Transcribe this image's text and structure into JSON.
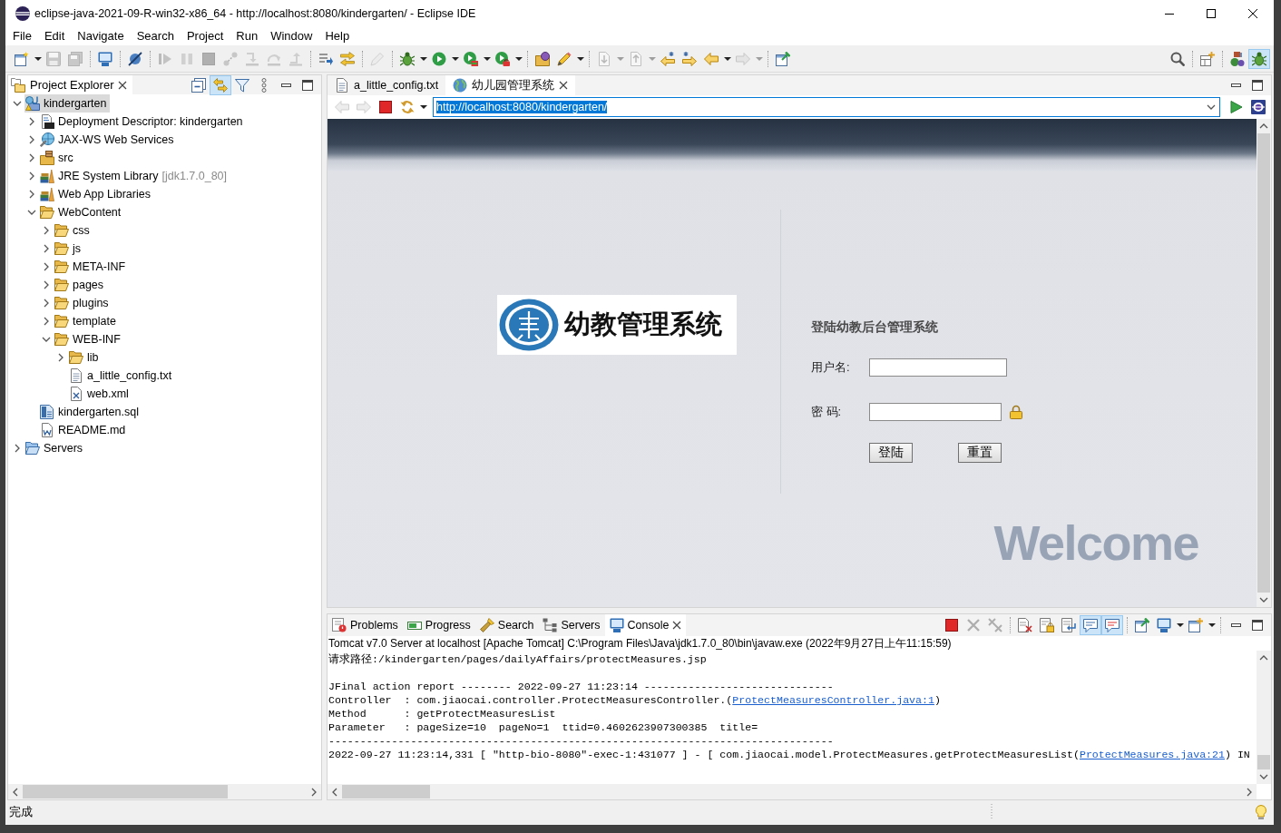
{
  "window": {
    "title": "eclipse-java-2021-09-R-win32-x86_64 - http://localhost:8080/kindergarten/ - Eclipse IDE"
  },
  "menu": [
    "File",
    "Edit",
    "Navigate",
    "Search",
    "Project",
    "Run",
    "Window",
    "Help"
  ],
  "toolbar": {
    "groups": [
      {
        "buttons": [
          {
            "kind": "new",
            "disabled": false,
            "dropdown": true
          },
          {
            "kind": "save",
            "disabled": true
          },
          {
            "kind": "save-all",
            "disabled": true
          }
        ]
      },
      {
        "buttons": [
          {
            "kind": "console",
            "disabled": false
          }
        ]
      },
      {
        "buttons": [
          {
            "kind": "skip-breakpoints",
            "disabled": false
          }
        ]
      },
      {
        "buttons": [
          {
            "kind": "resume",
            "disabled": true
          },
          {
            "kind": "suspend",
            "disabled": true
          },
          {
            "kind": "terminate",
            "disabled": true
          },
          {
            "kind": "disconnect",
            "disabled": true
          },
          {
            "kind": "step-into",
            "disabled": true
          },
          {
            "kind": "step-over",
            "disabled": true
          },
          {
            "kind": "step-return",
            "disabled": true
          }
        ]
      },
      {
        "buttons": [
          {
            "kind": "step-filters",
            "disabled": false
          },
          {
            "kind": "highlight",
            "disabled": false
          }
        ]
      },
      {
        "buttons": [
          {
            "kind": "pen",
            "disabled": true
          }
        ]
      },
      {
        "buttons": [
          {
            "kind": "debug",
            "disabled": false,
            "dropdown": true
          },
          {
            "kind": "run",
            "disabled": false,
            "dropdown": true
          },
          {
            "kind": "coverage",
            "disabled": false,
            "dropdown": true
          },
          {
            "kind": "external-tools",
            "disabled": false,
            "dropdown": true
          }
        ]
      },
      {
        "buttons": [
          {
            "kind": "open-type",
            "disabled": false
          },
          {
            "kind": "pencil",
            "disabled": false,
            "dropdown": true
          }
        ]
      },
      {
        "buttons": [
          {
            "kind": "next-annotation",
            "disabled": true,
            "dropdown": true
          },
          {
            "kind": "previous-annotation",
            "disabled": true,
            "dropdown": true
          },
          {
            "kind": "last-edit",
            "disabled": false
          },
          {
            "kind": "next-edit",
            "disabled": false
          },
          {
            "kind": "back",
            "disabled": false,
            "dropdown": true
          },
          {
            "kind": "forward",
            "disabled": true,
            "dropdown": true
          }
        ]
      },
      {
        "buttons": [
          {
            "kind": "pin-window",
            "disabled": false
          }
        ]
      }
    ],
    "right_groups": [
      {
        "buttons": [
          {
            "kind": "search",
            "selected": false
          }
        ]
      },
      {
        "buttons": [
          {
            "kind": "open-perspective",
            "selected": false
          }
        ]
      },
      {
        "buttons": [
          {
            "kind": "java-ee",
            "selected": false
          },
          {
            "kind": "debug-perspective",
            "selected": true
          }
        ]
      }
    ]
  },
  "project_explorer": {
    "title": "Project Explorer",
    "view_toolbar": [
      {
        "kind": "collapse-all",
        "toggled": false
      },
      {
        "kind": "link-with-editor",
        "toggled": true
      },
      {
        "kind": "filter",
        "toggled": false
      },
      {
        "kind": "view-menu",
        "toggled": false
      }
    ],
    "tree": [
      {
        "label": "kindergarten",
        "kind": "project",
        "expanded": true,
        "selected": true,
        "children": [
          {
            "label": "Deployment Descriptor: kindergarten",
            "kind": "descriptor",
            "expanded": false,
            "selected": false
          },
          {
            "label": "JAX-WS Web Services",
            "kind": "services",
            "expanded": false,
            "selected": false
          },
          {
            "label": "src",
            "kind": "source",
            "expanded": false,
            "selected": false
          },
          {
            "label": "JRE System Library",
            "decoration": "[jdk1.7.0_80]",
            "kind": "library",
            "expanded": false,
            "selected": false
          },
          {
            "label": "Web App Libraries",
            "kind": "library",
            "expanded": false,
            "selected": false
          },
          {
            "label": "WebContent",
            "kind": "folder",
            "expanded": true,
            "selected": false,
            "children": [
              {
                "label": "css",
                "kind": "folder",
                "expanded": false,
                "selected": false
              },
              {
                "label": "js",
                "kind": "folder",
                "expanded": false,
                "selected": false
              },
              {
                "label": "META-INF",
                "kind": "folder",
                "expanded": false,
                "selected": false
              },
              {
                "label": "pages",
                "kind": "folder",
                "expanded": false,
                "selected": false
              },
              {
                "label": "plugins",
                "kind": "folder",
                "expanded": false,
                "selected": false
              },
              {
                "label": "template",
                "kind": "folder",
                "expanded": false,
                "selected": false
              },
              {
                "label": "WEB-INF",
                "kind": "folder",
                "expanded": true,
                "selected": false,
                "children": [
                  {
                    "label": "lib",
                    "kind": "folder",
                    "expanded": false,
                    "selected": false
                  },
                  {
                    "label": "a_little_config.txt",
                    "kind": "text-file",
                    "selected": false
                  },
                  {
                    "label": "web.xml",
                    "kind": "xml-file",
                    "selected": false
                  }
                ]
              }
            ]
          },
          {
            "label": "kindergarten.sql",
            "kind": "sql-file",
            "selected": false
          },
          {
            "label": "README.md",
            "kind": "doc-file",
            "selected": false
          }
        ]
      },
      {
        "label": "Servers",
        "kind": "servers",
        "expanded": false,
        "selected": false
      }
    ]
  },
  "editor": {
    "tabs": [
      {
        "label": "a_little_config.txt",
        "kind": "text",
        "selected": false
      },
      {
        "label": "幼儿园管理系统",
        "kind": "web",
        "selected": true
      }
    ],
    "browser": {
      "toolbar": [
        {
          "kind": "back",
          "disabled": true
        },
        {
          "kind": "forward",
          "disabled": true
        },
        {
          "kind": "stop",
          "disabled": false
        },
        {
          "kind": "refresh",
          "disabled": false,
          "dropdown": true
        }
      ],
      "url": "http://localhost:8080/kindergarten/",
      "url_highlighted": true,
      "page": {
        "logo_text": "幼教管理系统",
        "login_title": "登陆幼教后台管理系统",
        "fields": [
          {
            "label": "用户名:",
            "kind": "text"
          },
          {
            "label": "密 码:",
            "kind": "password"
          }
        ],
        "buttons": [
          "登陆",
          "重置"
        ],
        "background_text": "Welcome"
      }
    }
  },
  "bottom_panel": {
    "tabs": [
      {
        "label": "Problems",
        "kind": "problems",
        "selected": false
      },
      {
        "label": "Progress",
        "kind": "progress",
        "selected": false
      },
      {
        "label": "Search",
        "kind": "search",
        "selected": false
      },
      {
        "label": "Servers",
        "kind": "servers",
        "selected": false
      },
      {
        "label": "Console",
        "kind": "console",
        "selected": true
      }
    ],
    "toolbar_groups": [
      {
        "buttons": [
          {
            "kind": "terminate",
            "disabled": false,
            "toggled": false
          },
          {
            "kind": "remove-launch",
            "disabled": true,
            "toggled": false
          },
          {
            "kind": "remove-all",
            "disabled": true,
            "toggled": false
          }
        ]
      },
      {
        "buttons": [
          {
            "kind": "clear-console",
            "disabled": false,
            "toggled": false
          },
          {
            "kind": "scroll-lock",
            "disabled": false,
            "toggled": false
          },
          {
            "kind": "word-wrap",
            "disabled": false,
            "toggled": false
          },
          {
            "kind": "show-on-output",
            "disabled": false,
            "toggled": true
          },
          {
            "kind": "show-on-error",
            "disabled": false,
            "toggled": true
          }
        ]
      },
      {
        "buttons": [
          {
            "kind": "pin-console",
            "disabled": false,
            "toggled": false
          },
          {
            "kind": "display-console",
            "disabled": false,
            "toggled": false,
            "dropdown": true
          },
          {
            "kind": "open-console",
            "disabled": false,
            "toggled": false,
            "dropdown": true
          }
        ]
      }
    ],
    "console": {
      "process": "Tomcat v7.0 Server at localhost [Apache Tomcat] C:\\Program Files\\Java\\jdk1.7.0_80\\bin\\javaw.exe  (2022年9月27日上午11:15:59)",
      "lines": [
        {
          "kind": "plain",
          "text": "请求路径:/kindergarten/pages/dailyAffairs/protectMeasures.jsp"
        },
        {
          "kind": "blank"
        },
        {
          "kind": "plain",
          "text": "JFinal action report -------- 2022-09-27 11:23:14 ------------------------------"
        },
        {
          "kind": "link",
          "text": "Controller  : com.jiaocai.controller.ProtectMeasuresController.(",
          "link": "ProtectMeasuresController.java:1",
          "after": ")"
        },
        {
          "kind": "plain",
          "text": "Method      : getProtectMeasuresList"
        },
        {
          "kind": "plain",
          "text": "Parameter   : pageSize=10  pageNo=1  ttid=0.4602623907300385  title="
        },
        {
          "kind": "plain",
          "text": "--------------------------------------------------------------------------------"
        },
        {
          "kind": "link",
          "text": "2022-09-27 11:23:14,331 [ \"http-bio-8080\"-exec-1:431077 ] - [ com.jiaocai.model.ProtectMeasures.getProtectMeasuresList(",
          "link": "ProtectMeasures.java:21",
          "after": ") IN"
        }
      ]
    }
  },
  "status_bar": {
    "message": "完成"
  }
}
